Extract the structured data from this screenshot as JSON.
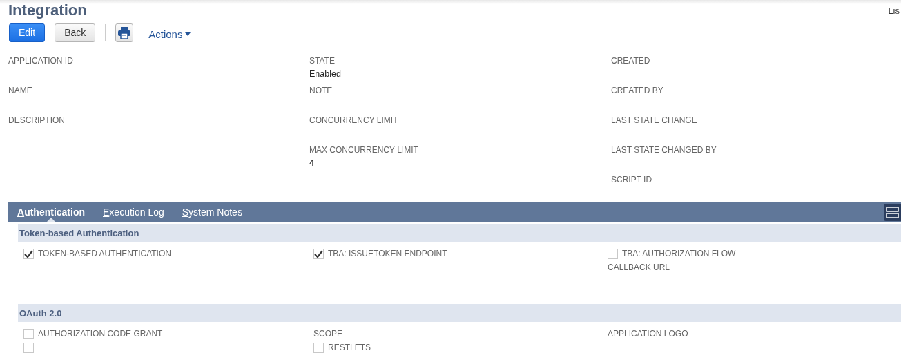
{
  "page_title": "Integration",
  "corner_text": "Lis",
  "toolbar": {
    "buttons": [
      {
        "label": "Edit",
        "kind": "primary"
      },
      {
        "label": "Back",
        "kind": "secondary"
      }
    ],
    "actions": "Actions"
  },
  "fields": [
    [
      {
        "label": "APPLICATION ID"
      },
      {
        "label": "NAME"
      },
      {
        "label": "DESCRIPTION"
      }
    ],
    [
      {
        "label": "STATE",
        "value": "Enabled"
      },
      {
        "label": "NOTE"
      },
      {
        "label": "CONCURRENCY LIMIT"
      },
      {
        "label": "MAX CONCURRENCY LIMIT",
        "value": "4"
      }
    ],
    [
      {
        "label": "CREATED"
      },
      {
        "label": "CREATED BY"
      },
      {
        "label": "LAST STATE CHANGE"
      },
      {
        "label": "LAST STATE CHANGED BY"
      },
      {
        "label": "SCRIPT ID"
      }
    ]
  ],
  "tabs": [
    {
      "label": "Authentication",
      "selected": true
    },
    {
      "label": "Execution Log",
      "selected": false
    },
    {
      "label": "System Notes",
      "selected": false
    }
  ],
  "sections": [
    {
      "title": "Token-based Authentication",
      "columns": [
        [
          {
            "kind": "checkbox",
            "label": "TOKEN-BASED AUTHENTICATION",
            "checked": true
          }
        ],
        [
          {
            "kind": "checkbox",
            "label": "TBA: ISSUETOKEN ENDPOINT",
            "checked": true
          }
        ],
        [
          {
            "kind": "checkbox",
            "label": "TBA: AUTHORIZATION FLOW",
            "checked": false
          },
          {
            "kind": "field",
            "label": "CALLBACK URL"
          }
        ]
      ]
    },
    {
      "title": "OAuth 2.0",
      "columns": [
        [
          {
            "kind": "checkbox",
            "label": "AUTHORIZATION CODE GRANT",
            "checked": false
          },
          {
            "kind": "checkbox",
            "checked": false
          }
        ],
        [
          {
            "kind": "field",
            "label": "SCOPE"
          },
          {
            "kind": "checkbox",
            "label": "RESTLETS",
            "checked": false
          }
        ],
        [
          {
            "kind": "field",
            "label": "APPLICATION LOGO"
          }
        ]
      ]
    }
  ]
}
